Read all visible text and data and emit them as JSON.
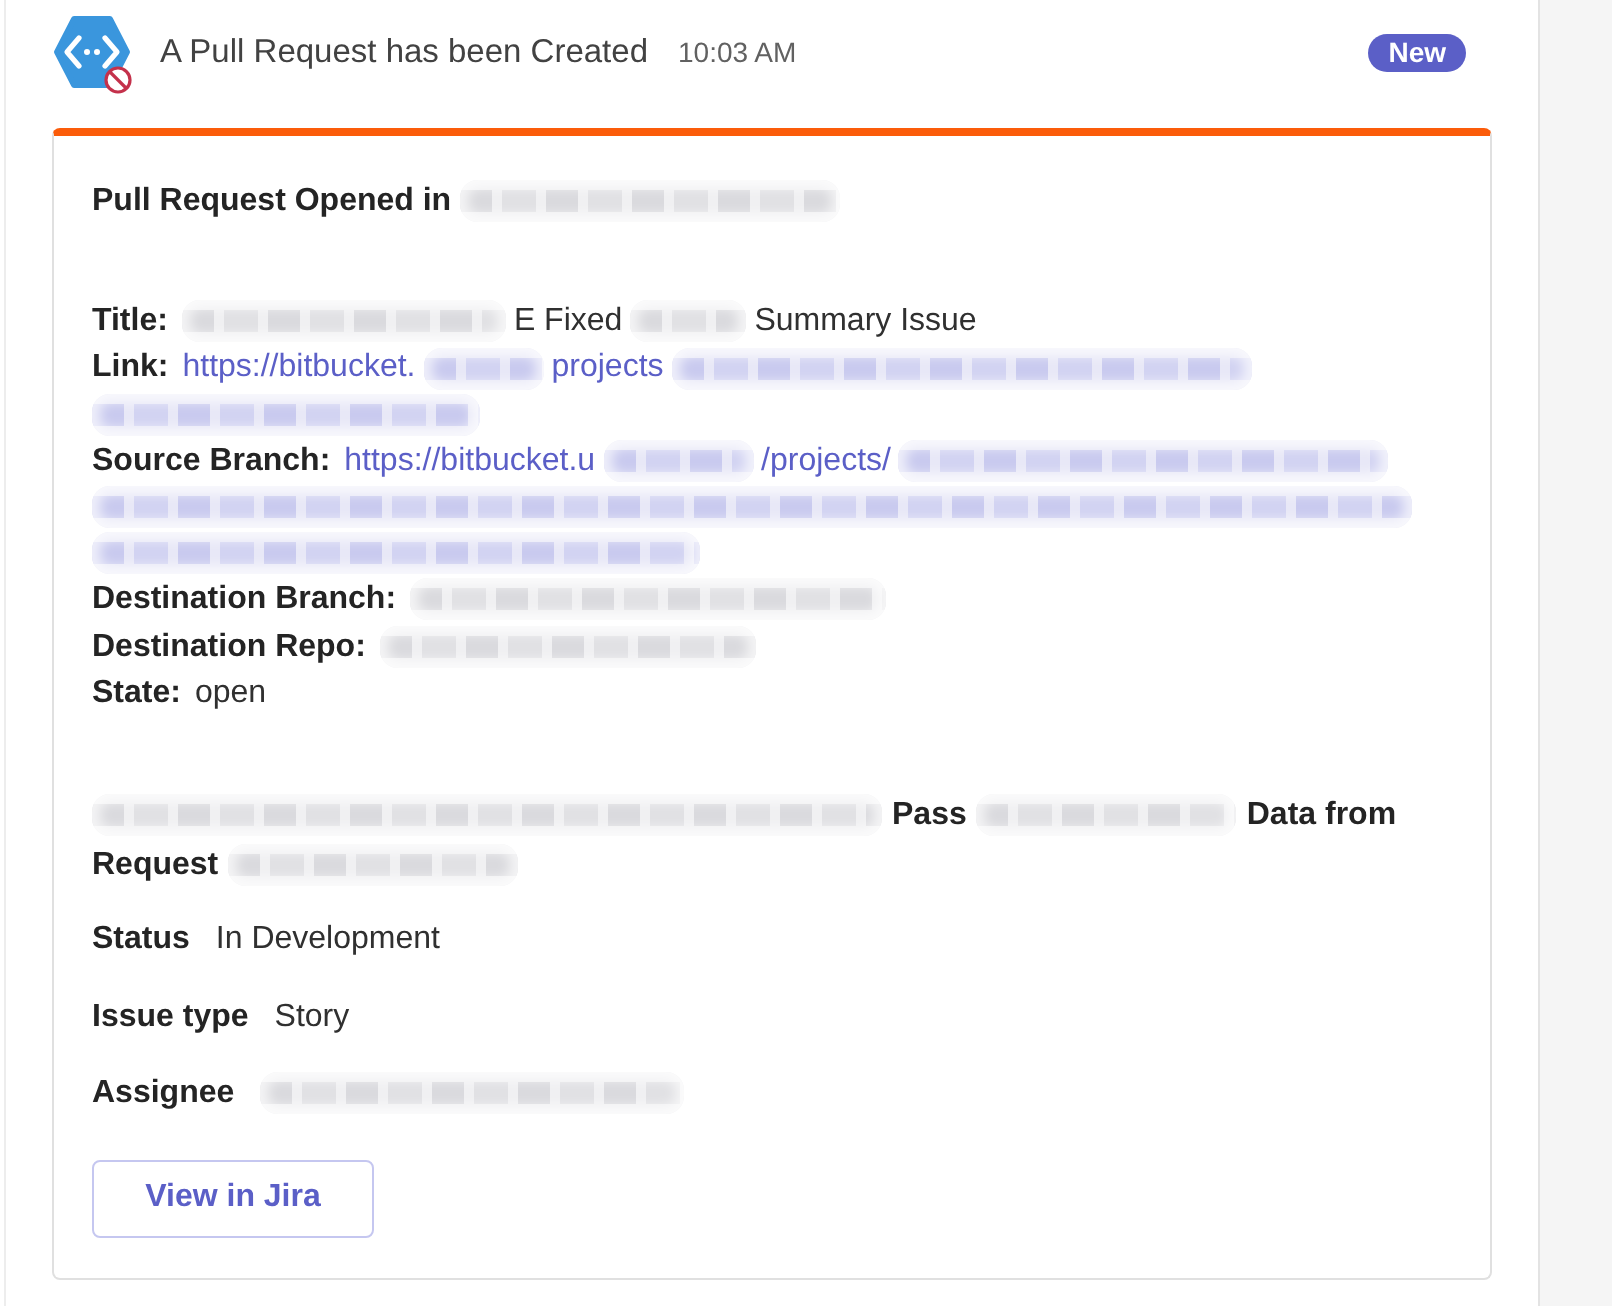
{
  "message": {
    "sender_blocked": true,
    "title": "A Pull Request has been Created",
    "time": "10:03 AM",
    "badge": "New"
  },
  "card": {
    "heading": [
      {
        "kind": "text",
        "text": "Pull Request Opened in"
      },
      {
        "kind": "redacted"
      }
    ],
    "fields": [
      {
        "label": "Title:",
        "value": [
          {
            "kind": "redacted"
          },
          {
            "kind": "text",
            "text": "E Fixed"
          },
          {
            "kind": "redacted"
          },
          {
            "kind": "text",
            "text": "Summary Issue"
          }
        ]
      },
      {
        "label": "Link:",
        "value": [
          {
            "kind": "link",
            "text": "https://bitbucket."
          },
          {
            "kind": "redacted_link"
          },
          {
            "kind": "link",
            "text": "projects"
          },
          {
            "kind": "redacted_link"
          },
          {
            "kind": "redacted_link"
          }
        ]
      },
      {
        "label": "Source Branch:",
        "value": [
          {
            "kind": "link",
            "text": "https://bitbucket.u"
          },
          {
            "kind": "redacted_link"
          },
          {
            "kind": "link",
            "text": "/projects/"
          },
          {
            "kind": "redacted_link"
          },
          {
            "kind": "redacted_link"
          },
          {
            "kind": "redacted_link"
          }
        ]
      },
      {
        "label": "Destination Branch:",
        "value": [
          {
            "kind": "redacted"
          }
        ]
      },
      {
        "label": "Destination Repo:",
        "value": [
          {
            "kind": "redacted"
          }
        ]
      },
      {
        "label": "State:",
        "value": [
          {
            "kind": "text",
            "text": "open"
          }
        ]
      }
    ],
    "issue": {
      "title": [
        {
          "kind": "redacted"
        },
        {
          "kind": "text",
          "text": "Pass"
        },
        {
          "kind": "redacted"
        },
        {
          "kind": "text",
          "text": "Data from"
        },
        {
          "kind": "text",
          "text": "Request"
        },
        {
          "kind": "redacted"
        }
      ],
      "details": [
        {
          "label": "Status",
          "value": [
            {
              "kind": "text",
              "text": "In Development"
            }
          ]
        },
        {
          "label": "Issue type",
          "value": [
            {
              "kind": "text",
              "text": "Story"
            }
          ]
        },
        {
          "label": "Assignee",
          "value": [
            {
              "kind": "redacted"
            }
          ]
        }
      ]
    },
    "button": "View in Jira"
  }
}
